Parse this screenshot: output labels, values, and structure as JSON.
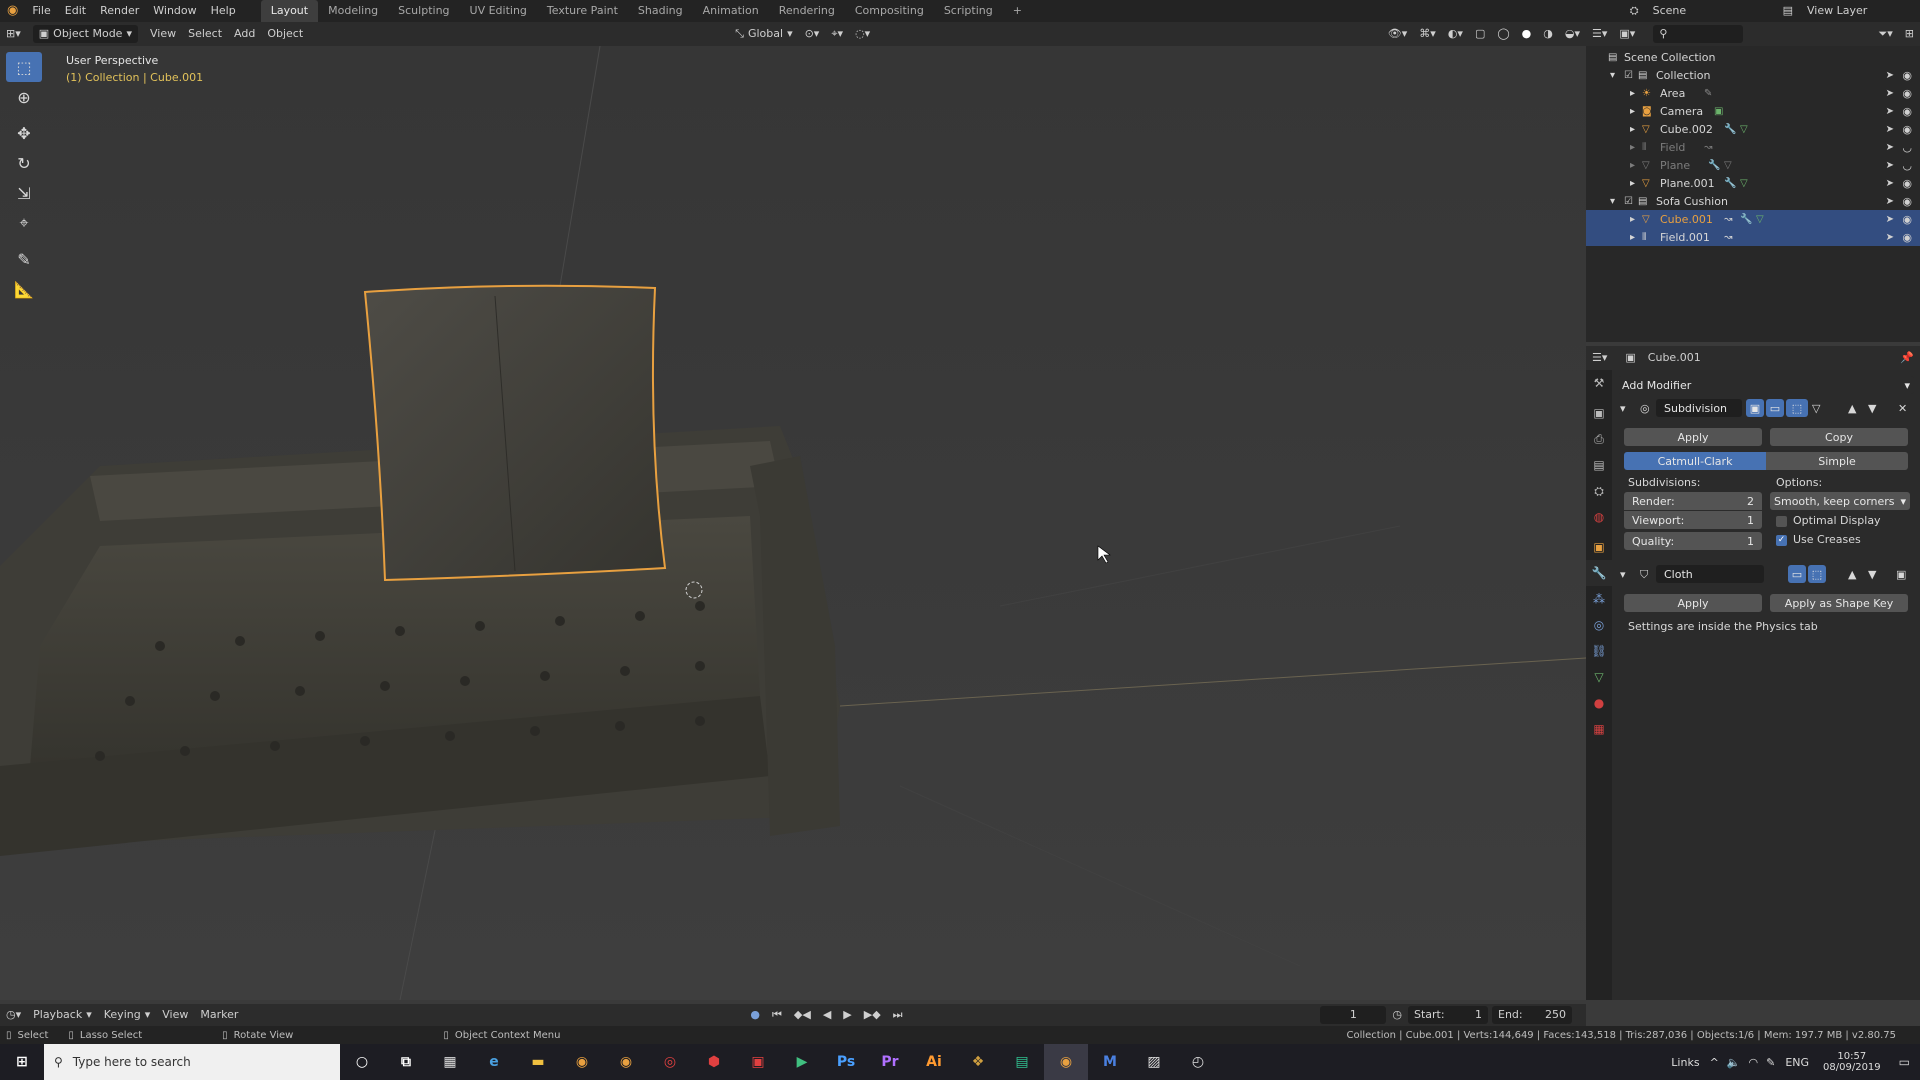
{
  "topbar": {
    "menus": [
      "File",
      "Edit",
      "Render",
      "Window",
      "Help"
    ],
    "workspaces": [
      "Layout",
      "Modeling",
      "Sculpting",
      "UV Editing",
      "Texture Paint",
      "Shading",
      "Animation",
      "Rendering",
      "Compositing",
      "Scripting",
      "+"
    ],
    "active_workspace": "Layout",
    "scene": "Scene",
    "view_layer": "View Layer"
  },
  "viewport_header": {
    "mode": "Object Mode",
    "menus": [
      "View",
      "Select",
      "Add",
      "Object"
    ],
    "transform_orientation": "Global"
  },
  "viewport": {
    "perspective": "User Perspective",
    "context": "(1) Collection | Cube.001"
  },
  "outliner": {
    "rows": [
      {
        "name": "Scene Collection",
        "indent": 0
      },
      {
        "name": "Collection",
        "indent": 1
      },
      {
        "name": "Area",
        "indent": 2
      },
      {
        "name": "Camera",
        "indent": 2
      },
      {
        "name": "Cube.002",
        "indent": 2
      },
      {
        "name": "Field",
        "indent": 2
      },
      {
        "name": "Plane",
        "indent": 2
      },
      {
        "name": "Plane.001",
        "indent": 2
      },
      {
        "name": "Sofa Cushion",
        "indent": 1
      },
      {
        "name": "Cube.001",
        "indent": 2
      },
      {
        "name": "Field.001",
        "indent": 2
      }
    ]
  },
  "properties": {
    "object_name": "Cube.001",
    "add_modifier": "Add Modifier",
    "subdivision": {
      "name": "Subdivision",
      "apply": "Apply",
      "copy": "Copy",
      "catmull_clark": "Catmull-Clark",
      "simple": "Simple",
      "subdivisions_label": "Subdivisions:",
      "options_label": "Options:",
      "render_label": "Render:",
      "render_value": "2",
      "viewport_label": "Viewport:",
      "viewport_value": "1",
      "quality_label": "Quality:",
      "quality_value": "1",
      "uv_smooth": "Smooth, keep corners",
      "optimal_display": "Optimal Display",
      "use_creases": "Use Creases"
    },
    "cloth": {
      "name": "Cloth",
      "apply": "Apply",
      "apply_shape_key": "Apply as Shape Key",
      "note": "Settings are inside the Physics tab"
    }
  },
  "timeline": {
    "menus": [
      "Playback",
      "Keying",
      "View",
      "Marker"
    ],
    "current_frame": "1",
    "start_label": "Start:",
    "start": "1",
    "end_label": "End:",
    "end": "250"
  },
  "statusbar": {
    "select": "Select",
    "lasso": "Lasso Select",
    "rotate": "Rotate View",
    "context_menu": "Object Context Menu",
    "stats": "Collection | Cube.001 | Verts:144,649 | Faces:143,518 | Tris:287,036 | Objects:1/6 | Mem: 197.7 MB | v2.80.75"
  },
  "taskbar": {
    "search_placeholder": "Type here to search",
    "links": "Links",
    "lang": "ENG",
    "time": "10:57",
    "date": "08/09/2019"
  },
  "colors": {
    "accent_blue": "#4772b3",
    "selection_orange": "#e8a040",
    "context_yellow": "#e2c25a"
  }
}
